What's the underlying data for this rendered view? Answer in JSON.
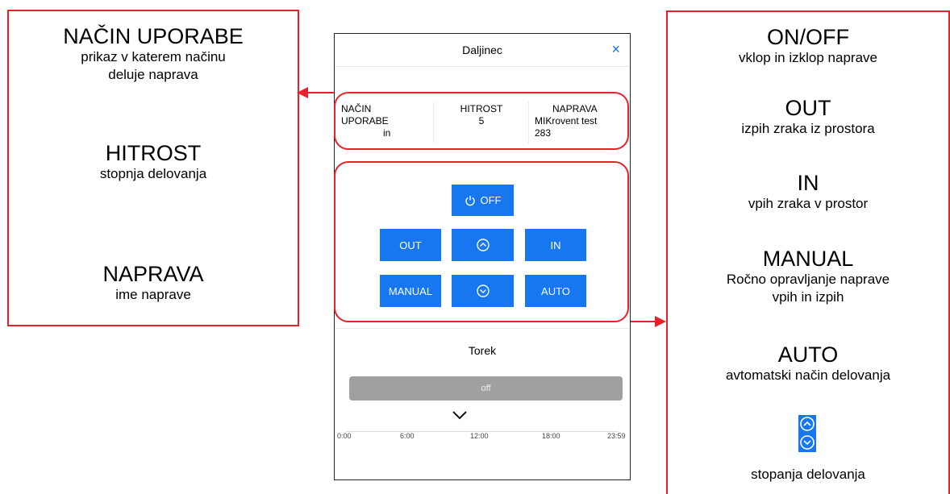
{
  "left_panel": {
    "mode_title": "NAČIN UPORABE",
    "mode_desc_1": "prikaz v katerem načinu",
    "mode_desc_2": "deluje naprava",
    "speed_title": "HITROST",
    "speed_desc": "stopnja delovanja",
    "device_title": "NAPRAVA",
    "device_desc": "ime naprave"
  },
  "right_panel": {
    "onoff_title": "ON/OFF",
    "onoff_desc": "vklop in izklop naprave",
    "out_title": "OUT",
    "out_desc": "izpih zraka iz prostora",
    "in_title": "IN",
    "in_desc": "vpih zraka v prostor",
    "manual_title": "MANUAL",
    "manual_desc_1": "Ročno opravljanje naprave",
    "manual_desc_2": "vpih in izpih",
    "auto_title": "AUTO",
    "auto_desc": "avtomatski način delovanja",
    "arrows_desc": "stopanja delovanja"
  },
  "app": {
    "title": "Daljinec",
    "close_icon": "×",
    "info": {
      "mode_label_1": "NAČIN",
      "mode_label_2": "UPORABE",
      "mode_value": "in",
      "speed_label": "HITROST",
      "speed_value": "5",
      "device_label": "NAPRAVA",
      "device_value_1": "MIKrovent test",
      "device_value_2": "283"
    },
    "buttons": {
      "off": "OFF",
      "out": "OUT",
      "in": "IN",
      "manual": "MANUAL",
      "auto": "AUTO"
    },
    "day": "Torek",
    "status_bar": "off",
    "timeline_ticks": [
      "0:00",
      "6:00",
      "12:00",
      "18:00",
      "23:59"
    ]
  },
  "colors": {
    "accent": "#1677f0",
    "annotation": "#e8202a"
  }
}
